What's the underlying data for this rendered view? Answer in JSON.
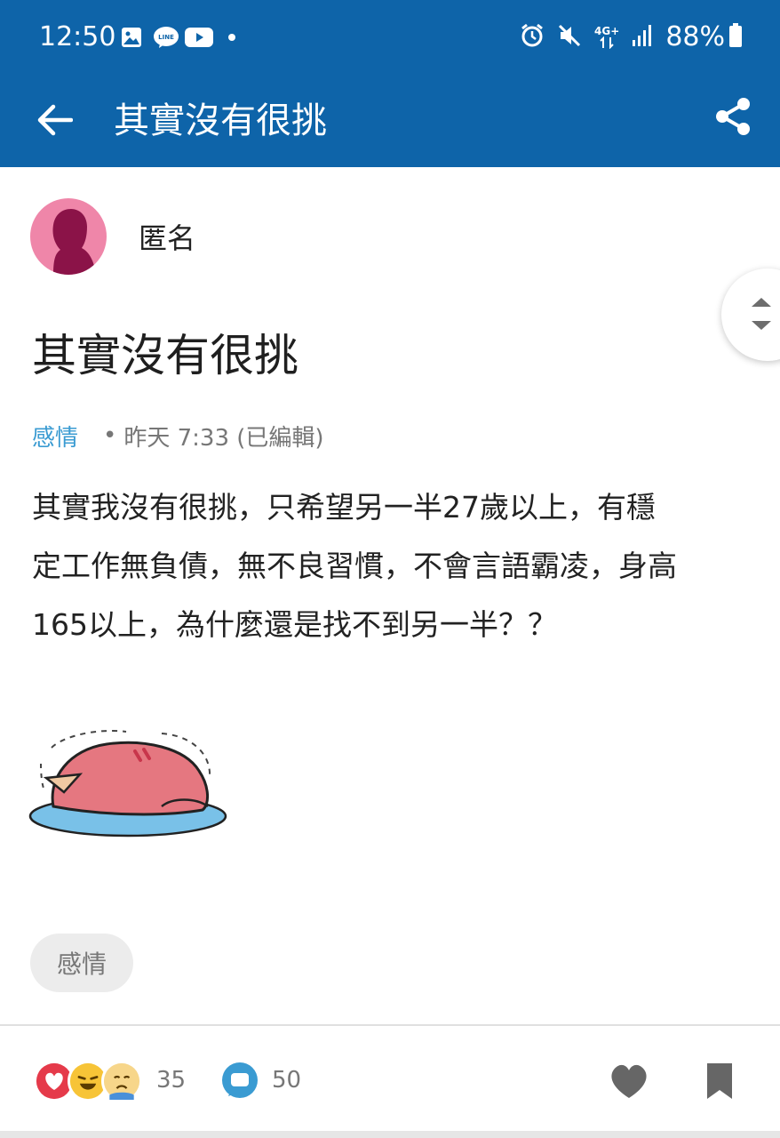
{
  "status_bar": {
    "time": "12:50",
    "network": "4G+",
    "battery": "88%",
    "icons": [
      "gallery-icon",
      "line-icon",
      "youtube-icon",
      "dot-icon",
      "alarm-icon",
      "mute-icon",
      "network-icon",
      "signal-icon",
      "battery-icon"
    ],
    "line_text": "LINE"
  },
  "app_bar": {
    "title": "其實沒有很挑",
    "back_icon": "arrow-left-icon",
    "share_icon": "share-icon",
    "color": "#0e64a9"
  },
  "post": {
    "author": "匿名",
    "title": "其實沒有很挑",
    "forum": "感情",
    "timestamp": "昨天 7:33 (已編輯)",
    "body_lines": [
      "其實我沒有很挑，只希望另一半27歲以上，有穩",
      "定工作無負債，無不良習慣，不會言語霸凌，身高",
      "165以上，為什麼還是找不到另一半？？"
    ],
    "tag": "感情",
    "forum_color": "#3a9bd2"
  },
  "bottom_bar": {
    "reaction_count": "35",
    "comment_count": "50",
    "reaction_icons": [
      "heart-reaction-icon",
      "laugh-reaction-icon",
      "cry-reaction-icon"
    ]
  }
}
